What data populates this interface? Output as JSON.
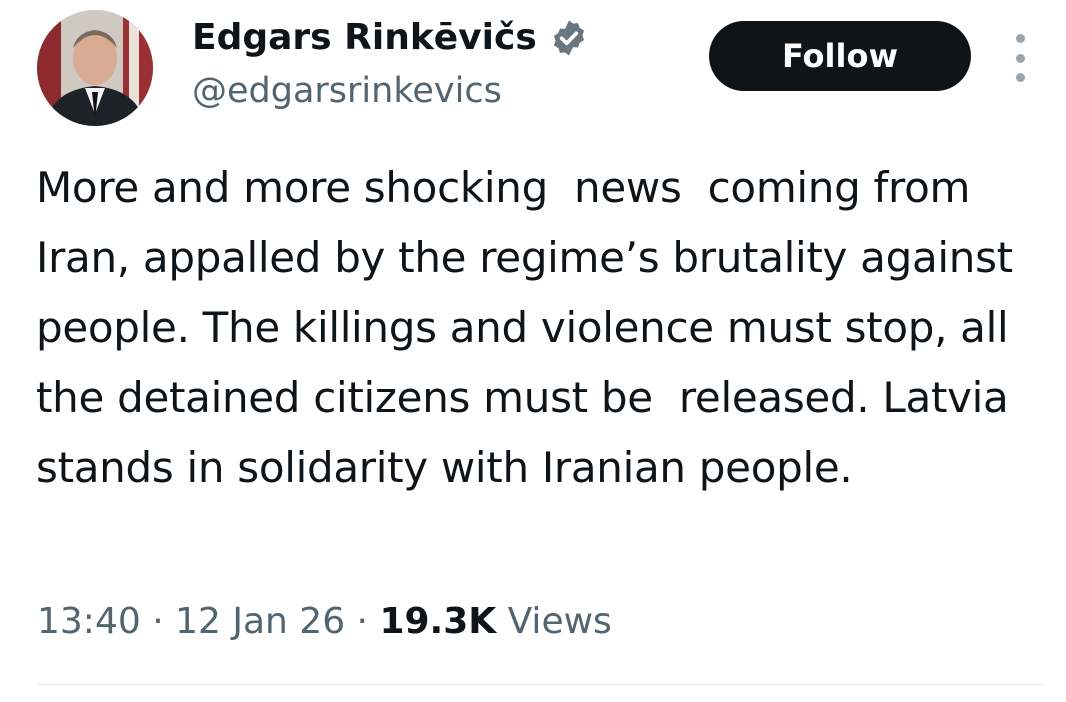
{
  "author": {
    "name": "Edgars Rinkēvičs",
    "handle": "@edgarsrinkevics",
    "verified_icon": "verified-badge-icon",
    "badge_color": "#536471"
  },
  "actions": {
    "follow_label": "Follow",
    "more_icon": "more-vertical-icon"
  },
  "tweet": {
    "text": "More and more shocking  news  coming from Iran, appalled by the regime’s brutality against people. The killings and violence must stop, all the detained citizens must be  released. Latvia stands in solidarity with Iranian people."
  },
  "meta": {
    "time": "13:40",
    "separator": " · ",
    "date": "12 Jan 26",
    "views_count": "19.3K",
    "views_label": " Views"
  }
}
